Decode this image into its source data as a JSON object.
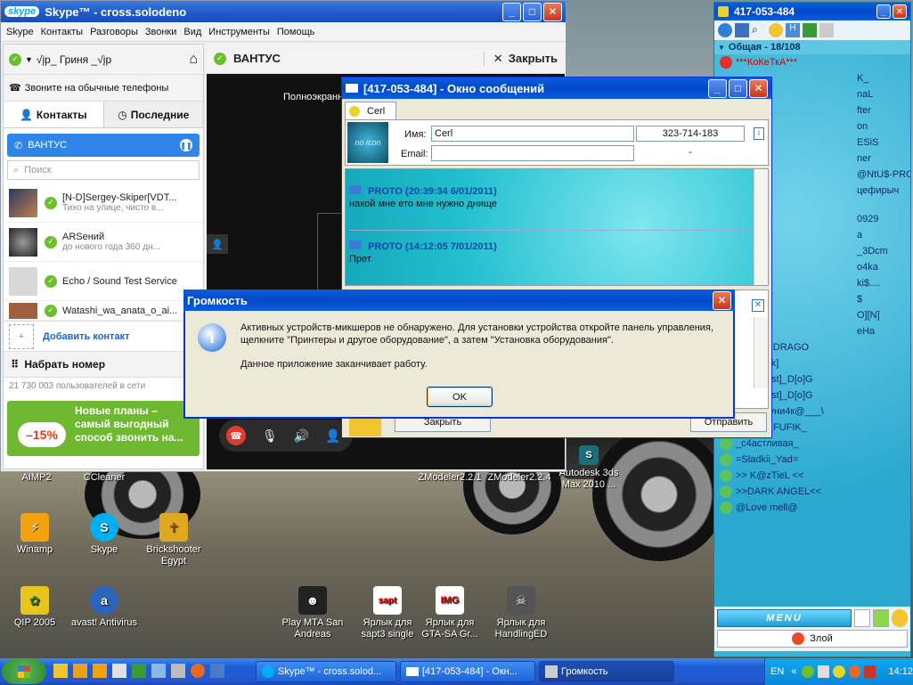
{
  "colors": {
    "skype_blue": "#00aff0",
    "xp_blue": "#0a5fdc",
    "qip_cyan": "#36b6d6",
    "skype_green": "#7ac142"
  },
  "skype": {
    "title": "Skype™ - cross.solodeno",
    "logo": "skype",
    "menu": [
      "Skype",
      "Контакты",
      "Разговоры",
      "Звонки",
      "Вид",
      "Инструменты",
      "Помощь"
    ],
    "profile_name": "√įp_ Гриня _√įp",
    "call_phones": "Звоните на обычные телефоны",
    "tab_contacts": "Контакты",
    "tab_recent": "Последние",
    "selected_contact": "ВАНТУС",
    "search_placeholder": "Поиск",
    "contacts": [
      {
        "name": "[N-D]Sergey-Skiper[VDT...",
        "sub": "Тихо на улице, чисто в..."
      },
      {
        "name": "ARSений",
        "sub": "до нового года 360 дн..."
      },
      {
        "name": "Echo / Sound Test Service",
        "sub": ""
      },
      {
        "name": "Watashi_wa_anata_o_ai...",
        "sub": ""
      }
    ],
    "add_contact": "Добавить контакт",
    "dial": "Набрать номер",
    "users_online": "21 730 003 пользователей в сети",
    "promo": "Новые планы – самый выгодный способ звонить на...",
    "promo_badge": "–15%",
    "call_header": "ВАНТУС",
    "close_label": "Закрыть",
    "fullscreen": "Полноэкранн"
  },
  "msgwin": {
    "title": "[417-053-484] - Окно сообщений",
    "tab": "Cerl",
    "name_label": "Имя:",
    "name_value": "Cerl",
    "uin": "323-714-183",
    "email_label": "Email:",
    "email_value": "-",
    "messages": [
      {
        "author": "PROTO (20:39:34 6/01/2011)",
        "text": "накой мне ето мне нужно днище"
      },
      {
        "author": "PROTO (14:12:05 7/01/2011)",
        "text": "Прет"
      }
    ],
    "btn_close": "Закрыть",
    "btn_send": "Отправить"
  },
  "volume_dialog": {
    "title": "Громкость",
    "message": "Активных устройств-микшеров не обнаружено. Для установки устройства откройте панель управления, щелкните \"Принтеры и другое оборудование\", а затем \"Установка оборудования\".",
    "message2": "Данное приложение заканчивает работу.",
    "ok": "OK"
  },
  "qip": {
    "title": "417-053-484",
    "group": "Общая - 18/108",
    "contacts": [
      "***КоКеТкА***",
      "K_",
      "naL",
      "fter",
      "on",
      "ESiS",
      "ner",
      "@NtU$-PRO",
      "цефирыч",
      "0929",
      "a",
      "_3Dcm",
      "o4ka",
      "ki$....",
      "$",
      "O][N]",
      "eHa",
      "[MaTrIX]DRAGO",
      "[ProRock]",
      "[PS_West]_D[o]G",
      "[PS_West]_D[o]G",
      "_\\_КыСуни4к@___\\",
      "_FATIK_FUFIK_",
      "_с4астливая_",
      "=Sladkii_Yad=",
      ">> K@zTieL <<",
      ">>DARK ANGEL<<",
      "@Love mell@"
    ],
    "menu_btn": "MENU",
    "status": "Злой"
  },
  "desktop_icons": [
    {
      "label": "AIMP2",
      "icon": "aimp-icon"
    },
    {
      "label": "CCleaner",
      "icon": "ccleaner-icon"
    },
    {
      "label": "Winamp",
      "icon": "winamp-icon"
    },
    {
      "label": "Skype",
      "icon": "skype-icon"
    },
    {
      "label": "Brickshooter Egypt",
      "icon": "ankh-icon"
    },
    {
      "label": "QIP 2005",
      "icon": "qip-icon"
    },
    {
      "label": "avast! Antivirus",
      "icon": "avast-icon"
    },
    {
      "label": "Play MTA San Andreas",
      "icon": "mta-icon"
    },
    {
      "label": "Ярлык для sapt3 single",
      "icon": "sapt-icon"
    },
    {
      "label": "Ярлык для GTA-SA Gr...",
      "icon": "img-icon"
    },
    {
      "label": "Ярлык для HandlingED",
      "icon": "handling-icon"
    },
    {
      "label": "ZModeler2.2.1",
      "icon": ""
    },
    {
      "label": "ZModeler2.2.4",
      "icon": ""
    },
    {
      "label": "Autodesk 3ds Max 2010 ...",
      "icon": "3ds-icon"
    }
  ],
  "taskbar": {
    "buttons": [
      {
        "label": "Skype™ - cross.solod..."
      },
      {
        "label": "[417-053-484] - Окн..."
      },
      {
        "label": "Громкость"
      }
    ],
    "lang": "EN",
    "time": "14:12"
  }
}
